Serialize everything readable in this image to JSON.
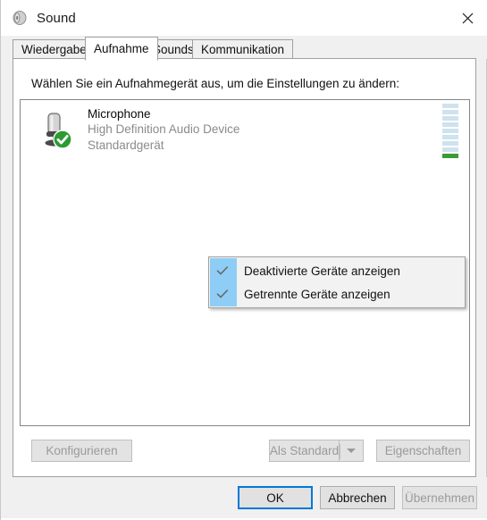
{
  "window": {
    "title": "Sound",
    "title_icon": "speaker-icon",
    "close_icon": "close-icon"
  },
  "tabs": [
    {
      "label": "Wiedergabe",
      "selected": false
    },
    {
      "label": "Aufnahme",
      "selected": true
    },
    {
      "label": "Sounds",
      "selected": false
    },
    {
      "label": "Kommunikation",
      "selected": false
    }
  ],
  "panel": {
    "prompt": "Wählen Sie ein Aufnahmegerät aus, um die Einstellungen zu ändern:"
  },
  "devices": [
    {
      "name": "Microphone",
      "driver": "High Definition Audio Device",
      "status": "Standardgerät",
      "icon": "microphone-icon",
      "badge": "green-check-badge",
      "meter": {
        "segments": 9,
        "active_from_bottom": 1,
        "inactive_color": "#cfe2ee",
        "active_color": "#3d9b35"
      }
    }
  ],
  "context_menu": {
    "items": [
      {
        "label": "Deaktivierte Geräte anzeigen",
        "checked": true
      },
      {
        "label": "Getrennte Geräte anzeigen",
        "checked": true
      }
    ],
    "check_icon": "checkmark-icon",
    "gutter_color": "#8ecdf5"
  },
  "mid_buttons": {
    "configure": {
      "label": "Konfigurieren",
      "enabled": false
    },
    "set_default": {
      "label": "Als Standard",
      "enabled": false
    },
    "dropdown_icon": "chevron-down-icon",
    "properties": {
      "label": "Eigenschaften",
      "enabled": false
    }
  },
  "command_buttons": {
    "ok": {
      "label": "OK",
      "enabled": true,
      "focused": true
    },
    "cancel": {
      "label": "Abbrechen",
      "enabled": true,
      "focused": false
    },
    "apply": {
      "label": "Übernehmen",
      "enabled": false,
      "focused": false
    }
  },
  "colors": {
    "accent": "#0078d7",
    "default_badge": "#3d9b35",
    "menu_highlight": "#8ecdf5"
  }
}
